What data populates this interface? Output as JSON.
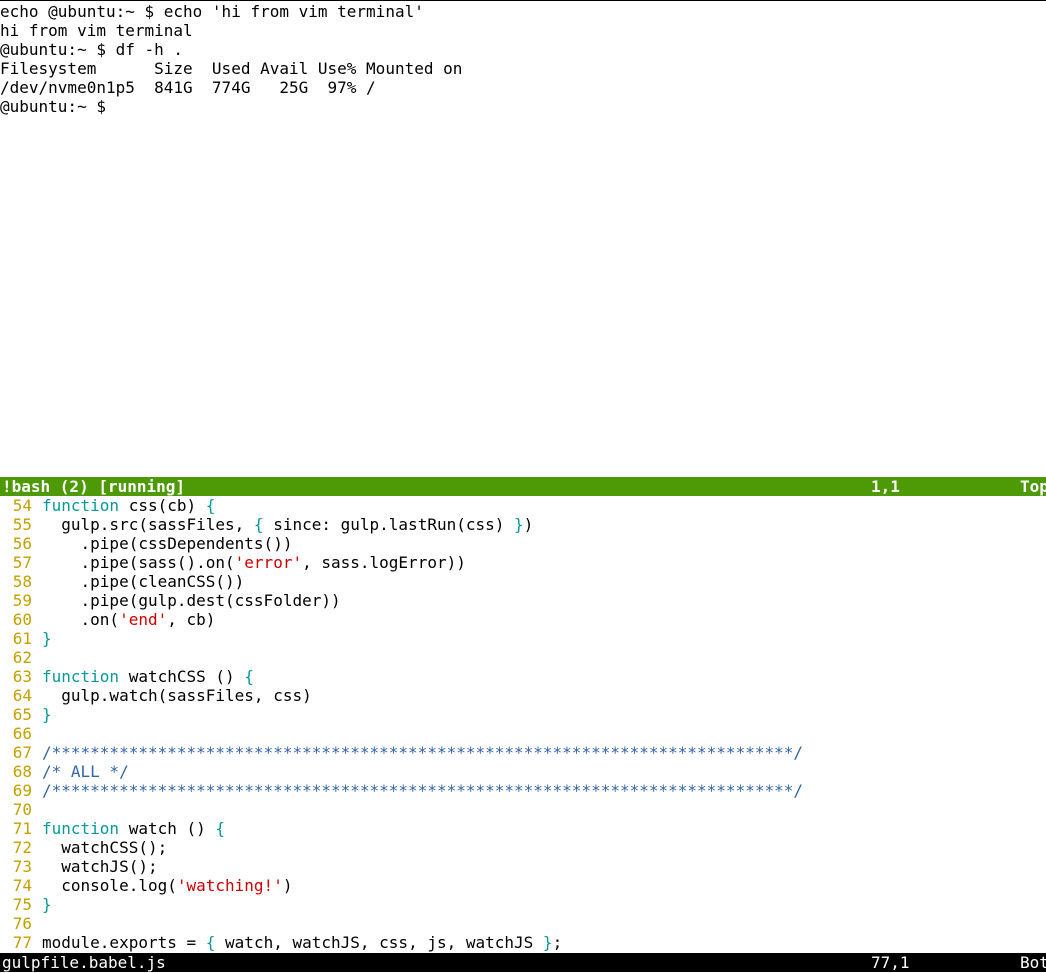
{
  "terminal": {
    "lines": [
      "echo @ubuntu:~ $ echo 'hi from vim terminal'",
      "hi from vim terminal",
      "@ubuntu:~ $ df -h .",
      "Filesystem      Size  Used Avail Use% Mounted on",
      "/dev/nvme0n1p5  841G  774G   25G  97% /",
      "@ubuntu:~ $"
    ]
  },
  "terminal_status": {
    "name": "!bash (2) [running]",
    "position": "1,1",
    "scroll": "Top"
  },
  "editor": {
    "lines": [
      {
        "n": "54",
        "tokens": [
          {
            "t": "function",
            "c": "kw"
          },
          {
            "t": " css(cb) ",
            "c": "plain"
          },
          {
            "t": "{",
            "c": "br"
          }
        ]
      },
      {
        "n": "55",
        "tokens": [
          {
            "t": "  gulp.src(sassFiles, ",
            "c": "plain"
          },
          {
            "t": "{",
            "c": "br"
          },
          {
            "t": " since: gulp.lastRun(css) ",
            "c": "plain"
          },
          {
            "t": "}",
            "c": "br"
          },
          {
            "t": ")",
            "c": "plain"
          }
        ]
      },
      {
        "n": "56",
        "tokens": [
          {
            "t": "    .pipe(cssDependents())",
            "c": "plain"
          }
        ]
      },
      {
        "n": "57",
        "tokens": [
          {
            "t": "    .pipe(sass().on(",
            "c": "plain"
          },
          {
            "t": "'error'",
            "c": "str"
          },
          {
            "t": ", sass.logError))",
            "c": "plain"
          }
        ]
      },
      {
        "n": "58",
        "tokens": [
          {
            "t": "    .pipe(cleanCSS())",
            "c": "plain"
          }
        ]
      },
      {
        "n": "59",
        "tokens": [
          {
            "t": "    .pipe(gulp.dest(cssFolder))",
            "c": "plain"
          }
        ]
      },
      {
        "n": "60",
        "tokens": [
          {
            "t": "    .on(",
            "c": "plain"
          },
          {
            "t": "'end'",
            "c": "str"
          },
          {
            "t": ", cb)",
            "c": "plain"
          }
        ]
      },
      {
        "n": "61",
        "tokens": [
          {
            "t": "}",
            "c": "br"
          }
        ]
      },
      {
        "n": "62",
        "tokens": []
      },
      {
        "n": "63",
        "tokens": [
          {
            "t": "function",
            "c": "kw"
          },
          {
            "t": " watchCSS () ",
            "c": "plain"
          },
          {
            "t": "{",
            "c": "br"
          }
        ]
      },
      {
        "n": "64",
        "tokens": [
          {
            "t": "  gulp.watch(sassFiles, css)",
            "c": "plain"
          }
        ]
      },
      {
        "n": "65",
        "tokens": [
          {
            "t": "}",
            "c": "br"
          }
        ]
      },
      {
        "n": "66",
        "tokens": []
      },
      {
        "n": "67",
        "tokens": [
          {
            "t": "/*****************************************************************************/",
            "c": "com"
          }
        ]
      },
      {
        "n": "68",
        "tokens": [
          {
            "t": "/* ALL */",
            "c": "com"
          }
        ]
      },
      {
        "n": "69",
        "tokens": [
          {
            "t": "/*****************************************************************************/",
            "c": "com"
          }
        ]
      },
      {
        "n": "70",
        "tokens": []
      },
      {
        "n": "71",
        "tokens": [
          {
            "t": "function",
            "c": "kw"
          },
          {
            "t": " watch () ",
            "c": "plain"
          },
          {
            "t": "{",
            "c": "br"
          }
        ]
      },
      {
        "n": "72",
        "tokens": [
          {
            "t": "  watchCSS();",
            "c": "plain"
          }
        ]
      },
      {
        "n": "73",
        "tokens": [
          {
            "t": "  watchJS();",
            "c": "plain"
          }
        ]
      },
      {
        "n": "74",
        "tokens": [
          {
            "t": "  console.log(",
            "c": "plain"
          },
          {
            "t": "'watching!'",
            "c": "str"
          },
          {
            "t": ")",
            "c": "plain"
          }
        ]
      },
      {
        "n": "75",
        "tokens": [
          {
            "t": "}",
            "c": "br"
          }
        ]
      },
      {
        "n": "76",
        "tokens": []
      },
      {
        "n": "77",
        "tokens": [
          {
            "t": "module.exports = ",
            "c": "plain"
          },
          {
            "t": "{",
            "c": "br"
          },
          {
            "t": " watch, watchJS, css, js, watchJS ",
            "c": "plain"
          },
          {
            "t": "}",
            "c": "br"
          },
          {
            "t": ";",
            "c": "plain"
          }
        ]
      }
    ]
  },
  "editor_status": {
    "filename": "gulpfile.babel.js",
    "position": "77,1",
    "scroll": "Bot"
  },
  "colors": {
    "terminal_status_bg": "#4e9a06",
    "line_number": "#c4a000",
    "keyword": "#06989a",
    "string": "#cc0000",
    "comment": "#3465a4"
  }
}
